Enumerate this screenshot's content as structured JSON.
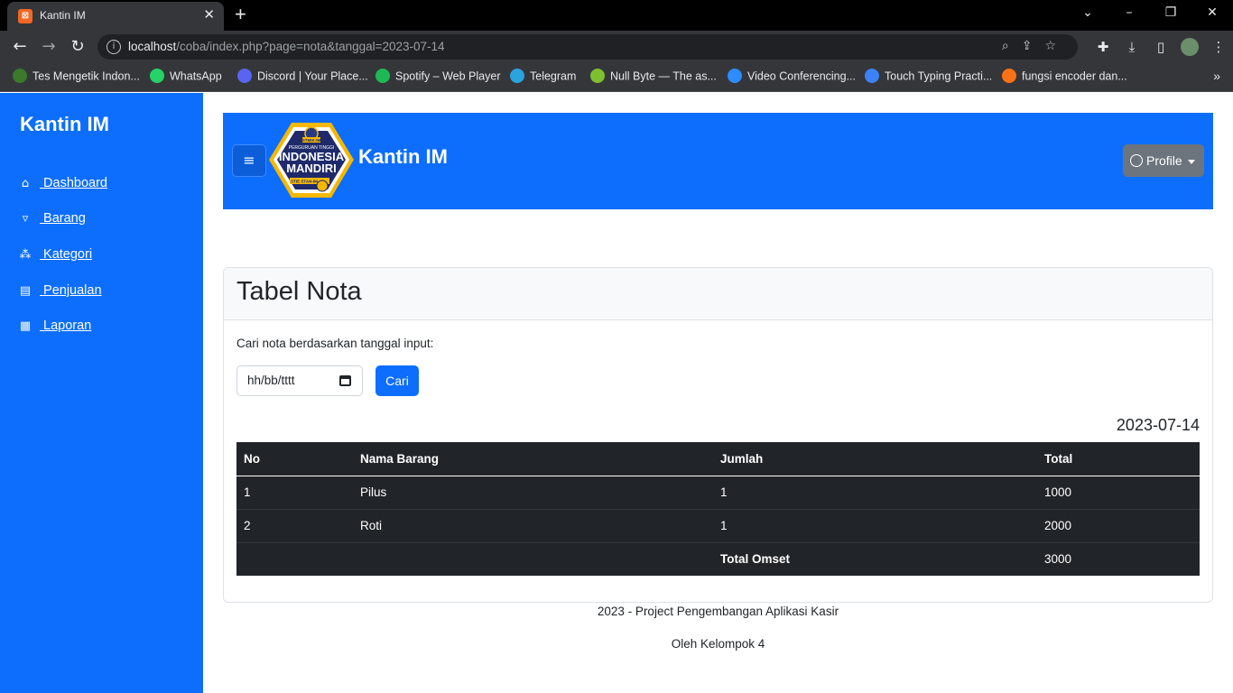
{
  "browser": {
    "tab_title": "Kantin IM",
    "url_host": "localhost",
    "url_path": "/coba/index.php?page=nota&tanggal=2023-07-14",
    "bookmarks": [
      {
        "label": "Tes Mengetik Indon...",
        "color": "#3c7a2b"
      },
      {
        "label": "WhatsApp",
        "color": "#25d366"
      },
      {
        "label": "Discord | Your Place...",
        "color": "#5865f2"
      },
      {
        "label": "Spotify – Web Player",
        "color": "#1db954"
      },
      {
        "label": "Telegram",
        "color": "#2aa3df"
      },
      {
        "label": "Null Byte — The as...",
        "color": "#7fbf2f"
      },
      {
        "label": "Video Conferencing...",
        "color": "#2d8cff"
      },
      {
        "label": "Touch Typing Practi...",
        "color": "#3b82f6"
      },
      {
        "label": "fungsi encoder dan...",
        "color": "#f97316"
      }
    ]
  },
  "sidebar": {
    "brand": "Kantin IM",
    "items": [
      {
        "label": " Dashboard",
        "icon": "home-icon"
      },
      {
        "label": " Barang",
        "icon": "basket-icon"
      },
      {
        "label": " Kategori",
        "icon": "boxes-icon"
      },
      {
        "label": " Penjualan",
        "icon": "shop-icon"
      },
      {
        "label": " Laporan",
        "icon": "table-icon"
      }
    ]
  },
  "header": {
    "title": "Kantin IM",
    "profile_label": "Profile",
    "logo": {
      "top": "PERGURUAN TINGGI",
      "line1": "INDONESIA",
      "line2": "MANDIRI",
      "badge": "STMIK-IM",
      "sub": "STIE STAN-IM"
    }
  },
  "card": {
    "title": "Tabel Nota",
    "search_label": "Cari nota berdasarkan tanggal input:",
    "date_placeholder": "hh/bb/tttt",
    "search_button": "Cari",
    "selected_date": "2023-07-14",
    "table": {
      "headers": [
        "No",
        "Nama Barang",
        "Jumlah",
        "Total"
      ],
      "rows": [
        [
          "1",
          "Pilus",
          "1",
          "1000"
        ],
        [
          "2",
          "Roti",
          "1",
          "2000"
        ]
      ],
      "total_label": "Total Omset",
      "total_value": "3000"
    }
  },
  "footer": {
    "line1": "2023 - Project Pengembangan Aplikasi Kasir",
    "line2": "Oleh Kelompok 4"
  },
  "colors": {
    "primary": "#0d6efd",
    "dark_table": "#212529",
    "secondary": "#6c757d"
  }
}
